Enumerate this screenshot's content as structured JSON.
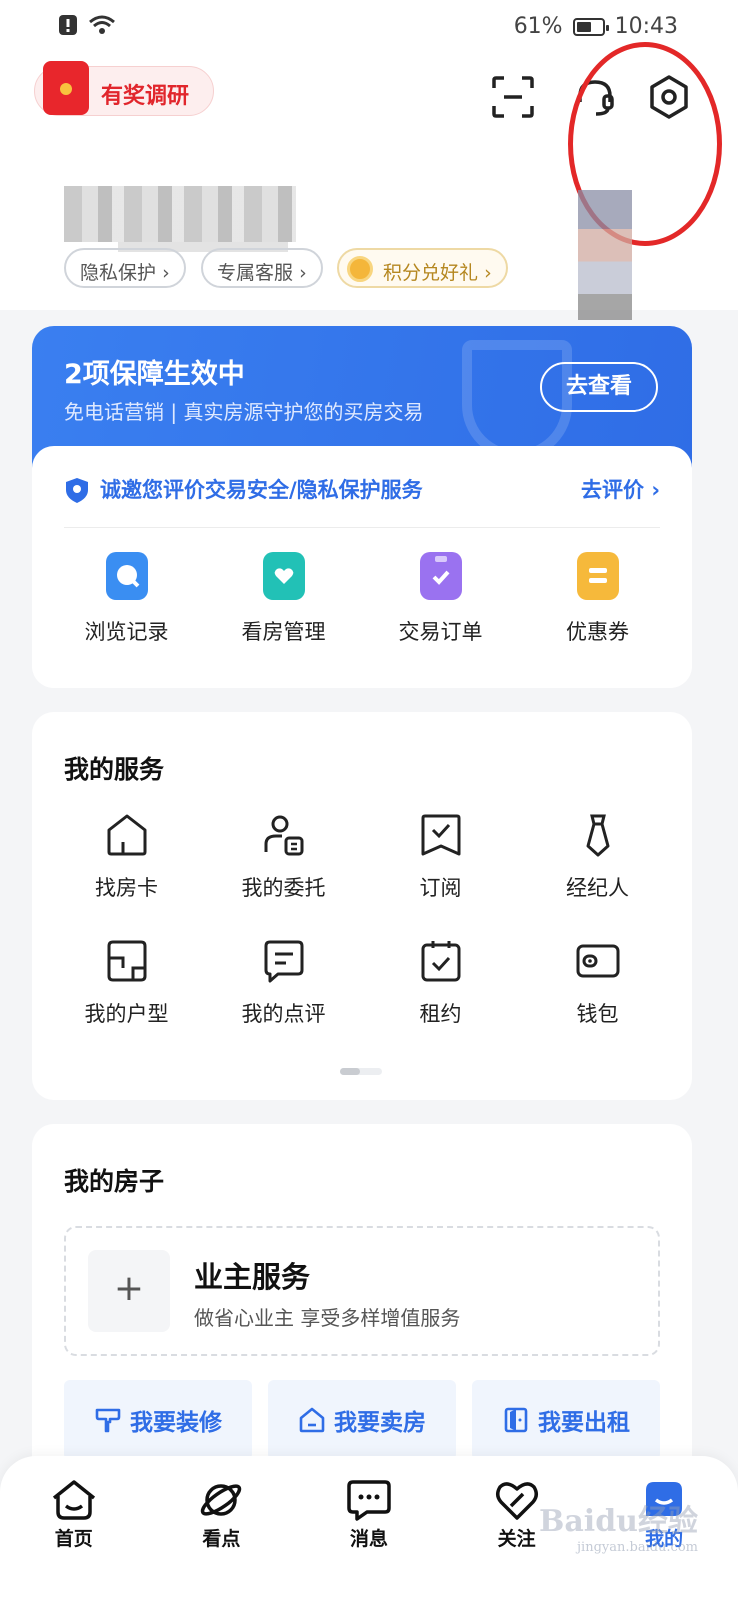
{
  "status_bar": {
    "battery": "61%",
    "battery_level": 0.61,
    "time": "10:43"
  },
  "header": {
    "survey_label": "有奖调研",
    "pills": [
      {
        "label": "隐私保护",
        "chevron": "›"
      },
      {
        "label": "专属客服",
        "chevron": "›"
      },
      {
        "label": "积分兑好礼",
        "chevron": "›"
      }
    ]
  },
  "protection": {
    "title": "2项保障生效中",
    "subtitle": "免电话营销 | 真实房源守护您的买房交易",
    "button": "去查看",
    "eval_text": "诚邀您评价交易安全/隐私保护服务",
    "eval_link": "去评价 ›",
    "quick_links": [
      {
        "label": "浏览记录",
        "icon": "browse-history-icon",
        "color": "#3a8ef2"
      },
      {
        "label": "看房管理",
        "icon": "house-heart-icon",
        "color": "#22c1b6"
      },
      {
        "label": "交易订单",
        "icon": "order-clipboard-icon",
        "color": "#9a72f0"
      },
      {
        "label": "优惠券",
        "icon": "coupon-icon",
        "color": "#f6b93b"
      }
    ]
  },
  "services": {
    "title": "我的服务",
    "items": [
      {
        "label": "找房卡",
        "icon": "house-icon"
      },
      {
        "label": "我的委托",
        "icon": "user-card-icon"
      },
      {
        "label": "订阅",
        "icon": "subscribe-icon"
      },
      {
        "label": "经纪人",
        "icon": "tie-icon"
      },
      {
        "label": "我的户型",
        "icon": "floorplan-icon"
      },
      {
        "label": "我的点评",
        "icon": "comment-icon"
      },
      {
        "label": "租约",
        "icon": "calendar-check-icon"
      },
      {
        "label": "钱包",
        "icon": "wallet-icon"
      }
    ]
  },
  "house": {
    "title": "我的房子",
    "owner_title": "业主服务",
    "owner_sub": "做省心业主 享受多样增值服务",
    "plus": "+",
    "actions": [
      {
        "label": "我要装修",
        "icon": "paint-roller-icon"
      },
      {
        "label": "我要卖房",
        "icon": "house-sell-icon"
      },
      {
        "label": "我要出租",
        "icon": "door-icon"
      }
    ]
  },
  "nav": {
    "items": [
      {
        "label": "首页",
        "icon": "home-icon"
      },
      {
        "label": "看点",
        "icon": "planet-icon"
      },
      {
        "label": "消息",
        "icon": "message-icon"
      },
      {
        "label": "关注",
        "icon": "heart-icon"
      },
      {
        "label": "我的",
        "icon": "mine-icon"
      }
    ]
  },
  "watermark": {
    "brand": "Baidu经验",
    "sub": "jingyan.baidu.com"
  },
  "colors": {
    "accent": "#2f6de6",
    "highlight_circle": "#e32828",
    "survey_red": "#e1262c"
  }
}
